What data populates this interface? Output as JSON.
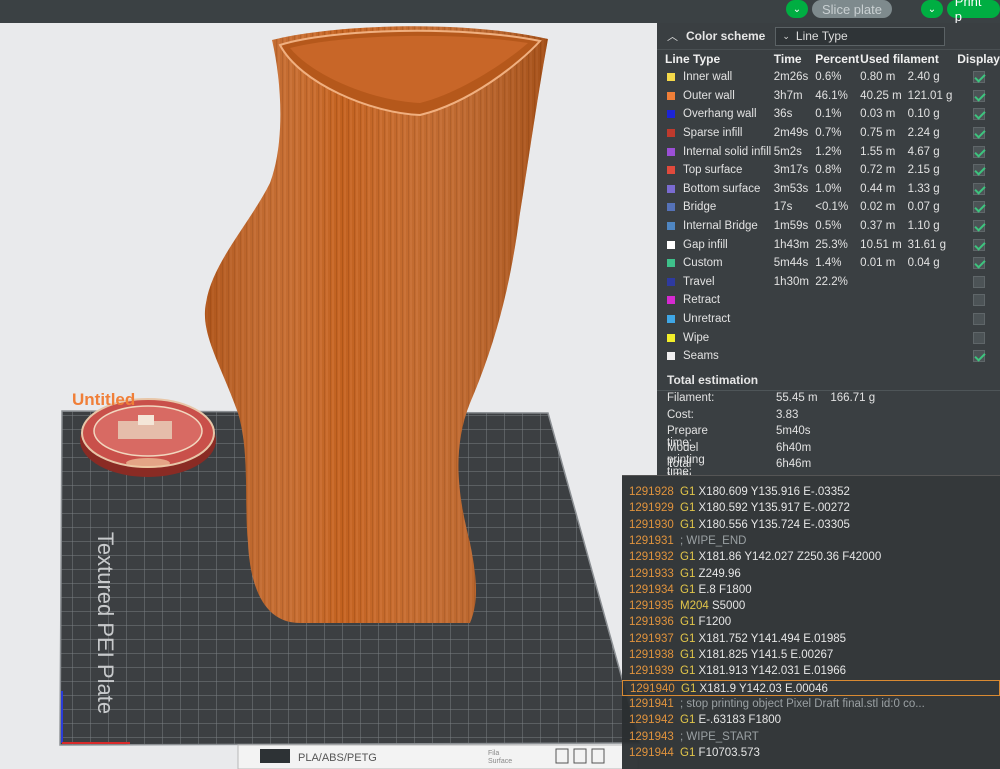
{
  "topbar": {
    "slice_label": "Slice plate",
    "print_label": "Print p"
  },
  "viewport": {
    "small_object_label": "Untitled",
    "plate_label": "Textured PEI Plate",
    "filament_badge": "PLA/ABS/PETG",
    "fila_label": "Fila",
    "surface_label": "Surface"
  },
  "panel": {
    "title": "Color scheme",
    "scheme_value": "Line Type",
    "columns": [
      "Line Type",
      "Time",
      "Percent",
      "Used filament",
      "Display"
    ],
    "rows": [
      {
        "name": "Inner wall",
        "color": "#f5d94a",
        "time": "2m26s",
        "percent": "0.6%",
        "length": "0.80 m",
        "weight": "2.40 g",
        "display": true
      },
      {
        "name": "Outer wall",
        "color": "#f07f38",
        "time": "3h7m",
        "percent": "46.1%",
        "length": "40.25 m",
        "weight": "121.01 g",
        "display": true
      },
      {
        "name": "Overhang wall",
        "color": "#1c24d6",
        "time": "36s",
        "percent": "0.1%",
        "length": "0.03 m",
        "weight": "0.10 g",
        "display": true
      },
      {
        "name": "Sparse infill",
        "color": "#bf3a2d",
        "time": "2m49s",
        "percent": "0.7%",
        "length": "0.75 m",
        "weight": "2.24 g",
        "display": true
      },
      {
        "name": "Internal solid infill",
        "color": "#9b4fd6",
        "time": "5m2s",
        "percent": "1.2%",
        "length": "1.55 m",
        "weight": "4.67 g",
        "display": true
      },
      {
        "name": "Top surface",
        "color": "#e04a3c",
        "time": "3m17s",
        "percent": "0.8%",
        "length": "0.72 m",
        "weight": "2.15 g",
        "display": true
      },
      {
        "name": "Bottom surface",
        "color": "#7a6bd1",
        "time": "3m53s",
        "percent": "1.0%",
        "length": "0.44 m",
        "weight": "1.33 g",
        "display": true
      },
      {
        "name": "Bridge",
        "color": "#5572b8",
        "time": "17s",
        "percent": "<0.1%",
        "length": "0.02 m",
        "weight": "0.07 g",
        "display": true
      },
      {
        "name": "Internal Bridge",
        "color": "#4f86c2",
        "time": "1m59s",
        "percent": "0.5%",
        "length": "0.37 m",
        "weight": "1.10 g",
        "display": true
      },
      {
        "name": "Gap infill",
        "color": "#ffffff",
        "time": "1h43m",
        "percent": "25.3%",
        "length": "10.51 m",
        "weight": "31.61 g",
        "display": true
      },
      {
        "name": "Custom",
        "color": "#3ec08a",
        "time": "5m44s",
        "percent": "1.4%",
        "length": "0.01 m",
        "weight": "0.04 g",
        "display": true
      },
      {
        "name": "Travel",
        "color": "#2e3aa0",
        "time": "1h30m",
        "percent": "22.2%",
        "length": "",
        "weight": "",
        "display": false
      },
      {
        "name": "Retract",
        "color": "#d62ad1",
        "time": "",
        "percent": "",
        "length": "",
        "weight": "",
        "display": false
      },
      {
        "name": "Unretract",
        "color": "#3fa7e6",
        "time": "",
        "percent": "",
        "length": "",
        "weight": "",
        "display": false
      },
      {
        "name": "Wipe",
        "color": "#f2ee2a",
        "time": "",
        "percent": "",
        "length": "",
        "weight": "",
        "display": false
      },
      {
        "name": "Seams",
        "color": "#f0f0f0",
        "time": "",
        "percent": "",
        "length": "",
        "weight": "",
        "display": true
      }
    ],
    "total": {
      "title": "Total estimation",
      "filament_label": "Filament:",
      "filament_value": "55.45 m    166.71 g",
      "cost_label": "Cost:",
      "cost_value": "3.83",
      "prepare_label": "Prepare time:",
      "prepare_value": "5m40s",
      "model_label": "Model printing time:",
      "model_value": "6h40m",
      "total_label": "Total time:",
      "total_value": "6h46m"
    }
  },
  "gcode": {
    "lines": [
      {
        "num": "1291928",
        "cmd": "G1",
        "args": "X180.609 Y135.916 E-.03352",
        "type": "g"
      },
      {
        "num": "1291929",
        "cmd": "G1",
        "args": "X180.592 Y135.917 E-.00272",
        "type": "g"
      },
      {
        "num": "1291930",
        "cmd": "G1",
        "args": "X180.556 Y135.724 E-.03305",
        "type": "g"
      },
      {
        "num": "1291931",
        "cmd": "",
        "args": "; WIPE_END",
        "type": "comment"
      },
      {
        "num": "1291932",
        "cmd": "G1",
        "args": "X181.86 Y142.027 Z250.36 F42000",
        "type": "g"
      },
      {
        "num": "1291933",
        "cmd": "G1",
        "args": "Z249.96",
        "type": "g"
      },
      {
        "num": "1291934",
        "cmd": "G1",
        "args": "E.8 F1800",
        "type": "g"
      },
      {
        "num": "1291935",
        "cmd": "M204",
        "args": "S5000",
        "type": "m"
      },
      {
        "num": "1291936",
        "cmd": "G1",
        "args": "F1200",
        "type": "g"
      },
      {
        "num": "1291937",
        "cmd": "G1",
        "args": "X181.752 Y141.494 E.01985",
        "type": "g"
      },
      {
        "num": "1291938",
        "cmd": "G1",
        "args": "X181.825 Y141.5 E.00267",
        "type": "g"
      },
      {
        "num": "1291939",
        "cmd": "G1",
        "args": "X181.913 Y142.031 E.01966",
        "type": "g"
      },
      {
        "num": "1291940",
        "cmd": "G1",
        "args": "X181.9 Y142.03 E.00046",
        "type": "g",
        "selected": true
      },
      {
        "num": "1291941",
        "cmd": "",
        "args": "; stop printing object Pixel Draft final.stl id:0 co...",
        "type": "comment"
      },
      {
        "num": "1291942",
        "cmd": "G1",
        "args": "E-.63183 F1800",
        "type": "g"
      },
      {
        "num": "1291943",
        "cmd": "",
        "args": "; WIPE_START",
        "type": "comment"
      },
      {
        "num": "1291944",
        "cmd": "G1",
        "args": "F10703.573",
        "type": "g"
      }
    ]
  }
}
